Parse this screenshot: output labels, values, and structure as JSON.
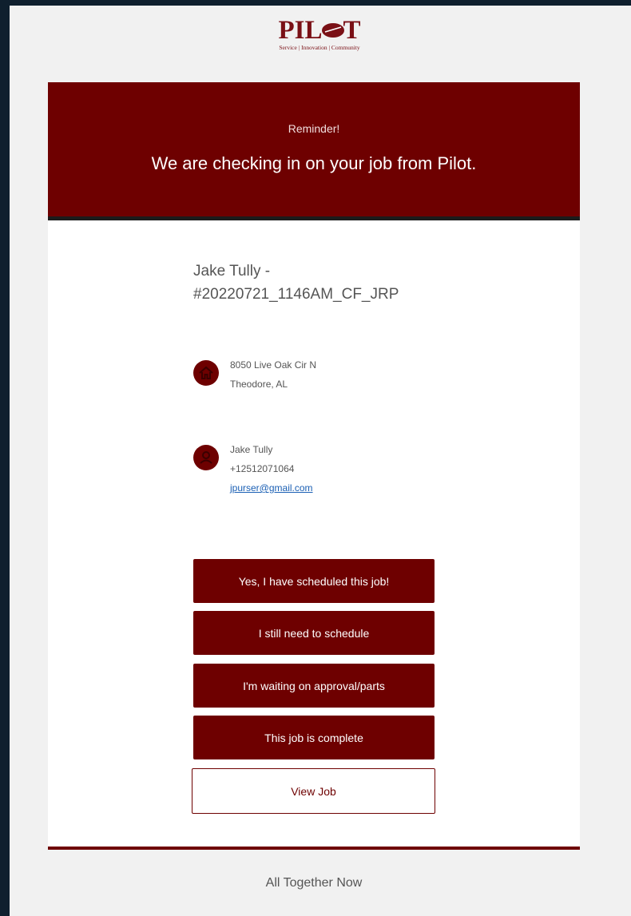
{
  "brand": {
    "wordmark_left": "PIL",
    "wordmark_right": "T",
    "tagline": "Service | Innovation | Community",
    "accent": "#6e0000"
  },
  "hero": {
    "kicker": "Reminder!",
    "headline": "We are checking in on your job from Pilot."
  },
  "job": {
    "title_line1": "Jake Tully -",
    "title_line2": "#20220721_1146AM_CF_JRP"
  },
  "address": {
    "icon": "home-icon",
    "line1": "8050 Live Oak Cir N",
    "line2": "Theodore, AL"
  },
  "contact": {
    "icon": "person-icon",
    "name": "Jake Tully",
    "phone": "+12512071064",
    "email": "jpurser@gmail.com"
  },
  "actions": {
    "scheduled": "Yes, I have scheduled this job!",
    "need_schedule": "I still need to schedule",
    "waiting": "I'm waiting on approval/parts",
    "complete": "This job is complete",
    "view": "View Job"
  },
  "footer": {
    "text": "All Together Now"
  }
}
